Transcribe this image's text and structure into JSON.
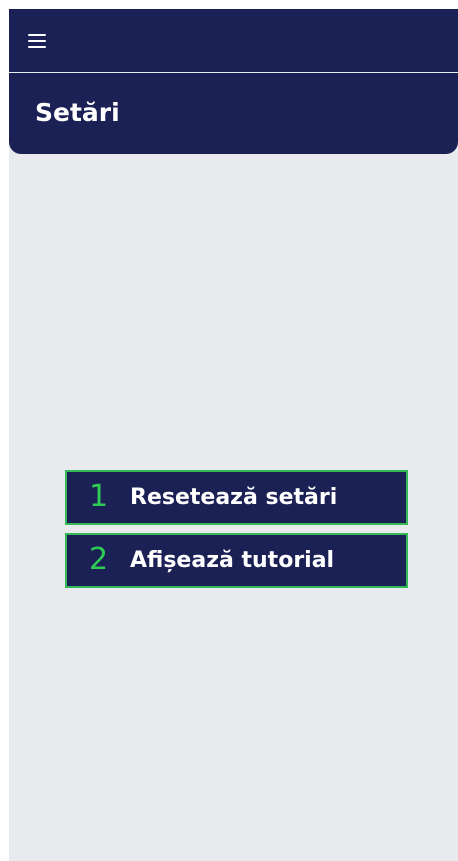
{
  "topbar": {
    "menu_icon": "hamburger-menu-icon"
  },
  "header": {
    "title": "Setări"
  },
  "settings": {
    "actions": [
      {
        "number": "1",
        "label": "Resetează setări"
      },
      {
        "number": "2",
        "label": "Afișează tutorial"
      }
    ]
  },
  "colors": {
    "primary": "#1c2155",
    "accent": "#2ecc55",
    "background": "#e8eaee",
    "text_on_primary": "#ffffff"
  }
}
